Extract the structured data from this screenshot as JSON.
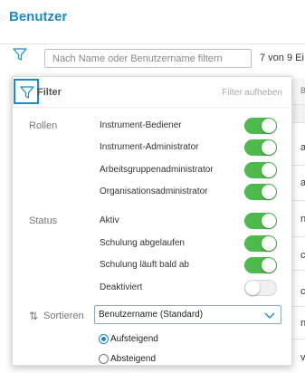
{
  "page": {
    "title": "Benutzer"
  },
  "toolbar": {
    "search_placeholder": "Nach Name oder Benutzername filtern",
    "count_text": "7 von 9 Ei"
  },
  "filter_panel": {
    "title": "Filter",
    "reset_label": "Filter aufheben",
    "roles": {
      "label": "Rollen",
      "options": [
        {
          "label": "Instrument-Bediener",
          "enabled": true
        },
        {
          "label": "Instrument-Administrator",
          "enabled": true
        },
        {
          "label": "Arbeitsgruppenadministrator",
          "enabled": true
        },
        {
          "label": "Organisationsadministrator",
          "enabled": true
        }
      ]
    },
    "status": {
      "label": "Status",
      "options": [
        {
          "label": "Aktiv",
          "enabled": true
        },
        {
          "label": "Schulung abgelaufen",
          "enabled": true
        },
        {
          "label": "Schulung läuft bald ab",
          "enabled": true
        },
        {
          "label": "Deaktiviert",
          "enabled": false
        }
      ]
    },
    "sort": {
      "label": "Sortieren",
      "selected": "Benutzername (Standard)",
      "order_options": [
        {
          "label": "Aufsteigend",
          "checked": true
        },
        {
          "label": "Absteigend",
          "checked": false
        }
      ]
    }
  },
  "background_table": {
    "header_fragment": "B",
    "cell_fragments": [
      "a",
      "a",
      "n",
      "c",
      "c",
      "n",
      "v"
    ]
  },
  "colors": {
    "accent": "#1a8ac9",
    "toggle_on": "#4cba4c",
    "toggle_off": "#f0f0f0"
  }
}
